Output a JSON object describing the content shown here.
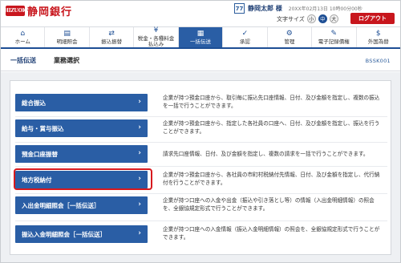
{
  "header": {
    "logo_mark": "SHIZUOKA",
    "bank_name": "静岡銀行",
    "user_badge": "77",
    "user_name": "静岡太郎 様",
    "last_login": "20XX年02月13日 10時00分00秒",
    "text_size_label": "文字サイズ",
    "text_sizes": [
      "小",
      "中",
      "大"
    ],
    "logout_label": "ログアウト"
  },
  "nav": {
    "items": [
      {
        "label": "ホーム",
        "icon": "home-icon",
        "glyph": "⌂"
      },
      {
        "label": "明細照会",
        "icon": "document-icon",
        "glyph": "▤"
      },
      {
        "label": "振込振替",
        "icon": "transfer-icon",
        "glyph": "⇄"
      },
      {
        "label": "税金・各種料金\n払込み",
        "icon": "tax-icon",
        "glyph": "¥"
      },
      {
        "label": "一括伝送",
        "icon": "bulk-transfer-icon",
        "glyph": "▦"
      },
      {
        "label": "承認",
        "icon": "approval-icon",
        "glyph": "✓"
      },
      {
        "label": "管理",
        "icon": "admin-icon",
        "glyph": "⚙"
      },
      {
        "label": "電子記録債権",
        "icon": "e-bond-icon",
        "glyph": "✎"
      },
      {
        "label": "外国為替",
        "icon": "forex-icon",
        "glyph": "$"
      }
    ],
    "active_index": 4
  },
  "page": {
    "breadcrumb_1": "一括伝送",
    "breadcrumb_2": "業務選択",
    "screen_id": "BSSK001"
  },
  "menu": {
    "items": [
      {
        "label": "総合振込",
        "desc": "企業が持つ預金口座から、取引毎に振込先口座情報、日付、及び金額を指定し、複数の振込を一括で行うことができます。"
      },
      {
        "label": "給与・賞与振込",
        "desc": "企業が持つ預金口座から、指定した各社員の口座へ、日付、及び金額を指定し、振込を行うことができます。"
      },
      {
        "label": "預金口座振替",
        "desc": "請求先口座情報、日付、及び金額を指定し、複数の請求を一括で行うことができます。"
      },
      {
        "label": "地方税納付",
        "desc": "企業が持つ預金口座から、各社員の市町村税納付先情報、日付、及び金額を指定し、代行納付を行うことができます。"
      },
      {
        "label": "入出金明細照会［一括伝送］",
        "desc": "企業が持つ口座への入金や出金（振込や引き落とし等）の情報（入出金明細情報）の照会を、全銀協規定形式で行うことができます。"
      },
      {
        "label": "振込入金明細照会［一括伝送］",
        "desc": "企業が持つ口座への入金情報（振込入金明細情報）の照会を、全銀協規定形式で行うことができます。"
      }
    ],
    "highlighted_index": 3,
    "chevron": "›"
  },
  "colors": {
    "brand_red": "#c8161d",
    "nav_blue": "#2a5ea5",
    "highlight_red": "#d7191e"
  }
}
